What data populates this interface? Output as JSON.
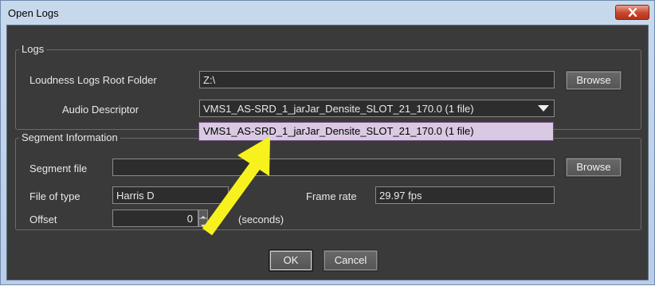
{
  "window": {
    "title": "Open Logs"
  },
  "logs": {
    "legend": "Logs",
    "root_label": "Loudness Logs Root Folder",
    "root_value": "Z:\\",
    "browse": "Browse",
    "audio_label": "Audio Descriptor",
    "audio_value": "VMS1_AS-SRD_1_jarJar_Densite_SLOT_21_170.0 (1 file)",
    "dropdown_options": [
      "VMS1_AS-SRD_1_jarJar_Densite_SLOT_21_170.0 (1 file)"
    ]
  },
  "segment": {
    "legend": "Segment Information",
    "file_label": "Segment file",
    "file_value": "",
    "browse": "Browse",
    "type_label": "File of type",
    "type_value": "Harris D",
    "rate_label": "Frame rate",
    "rate_value": "29.97 fps",
    "offset_label": "Offset",
    "offset_value": "0",
    "offset_unit": "(seconds)"
  },
  "buttons": {
    "ok": "OK",
    "cancel": "Cancel"
  },
  "colors": {
    "arrow": "#f7f21d",
    "dropdown_selected": "#d9c9e2",
    "panel": "#3a3a3a"
  }
}
